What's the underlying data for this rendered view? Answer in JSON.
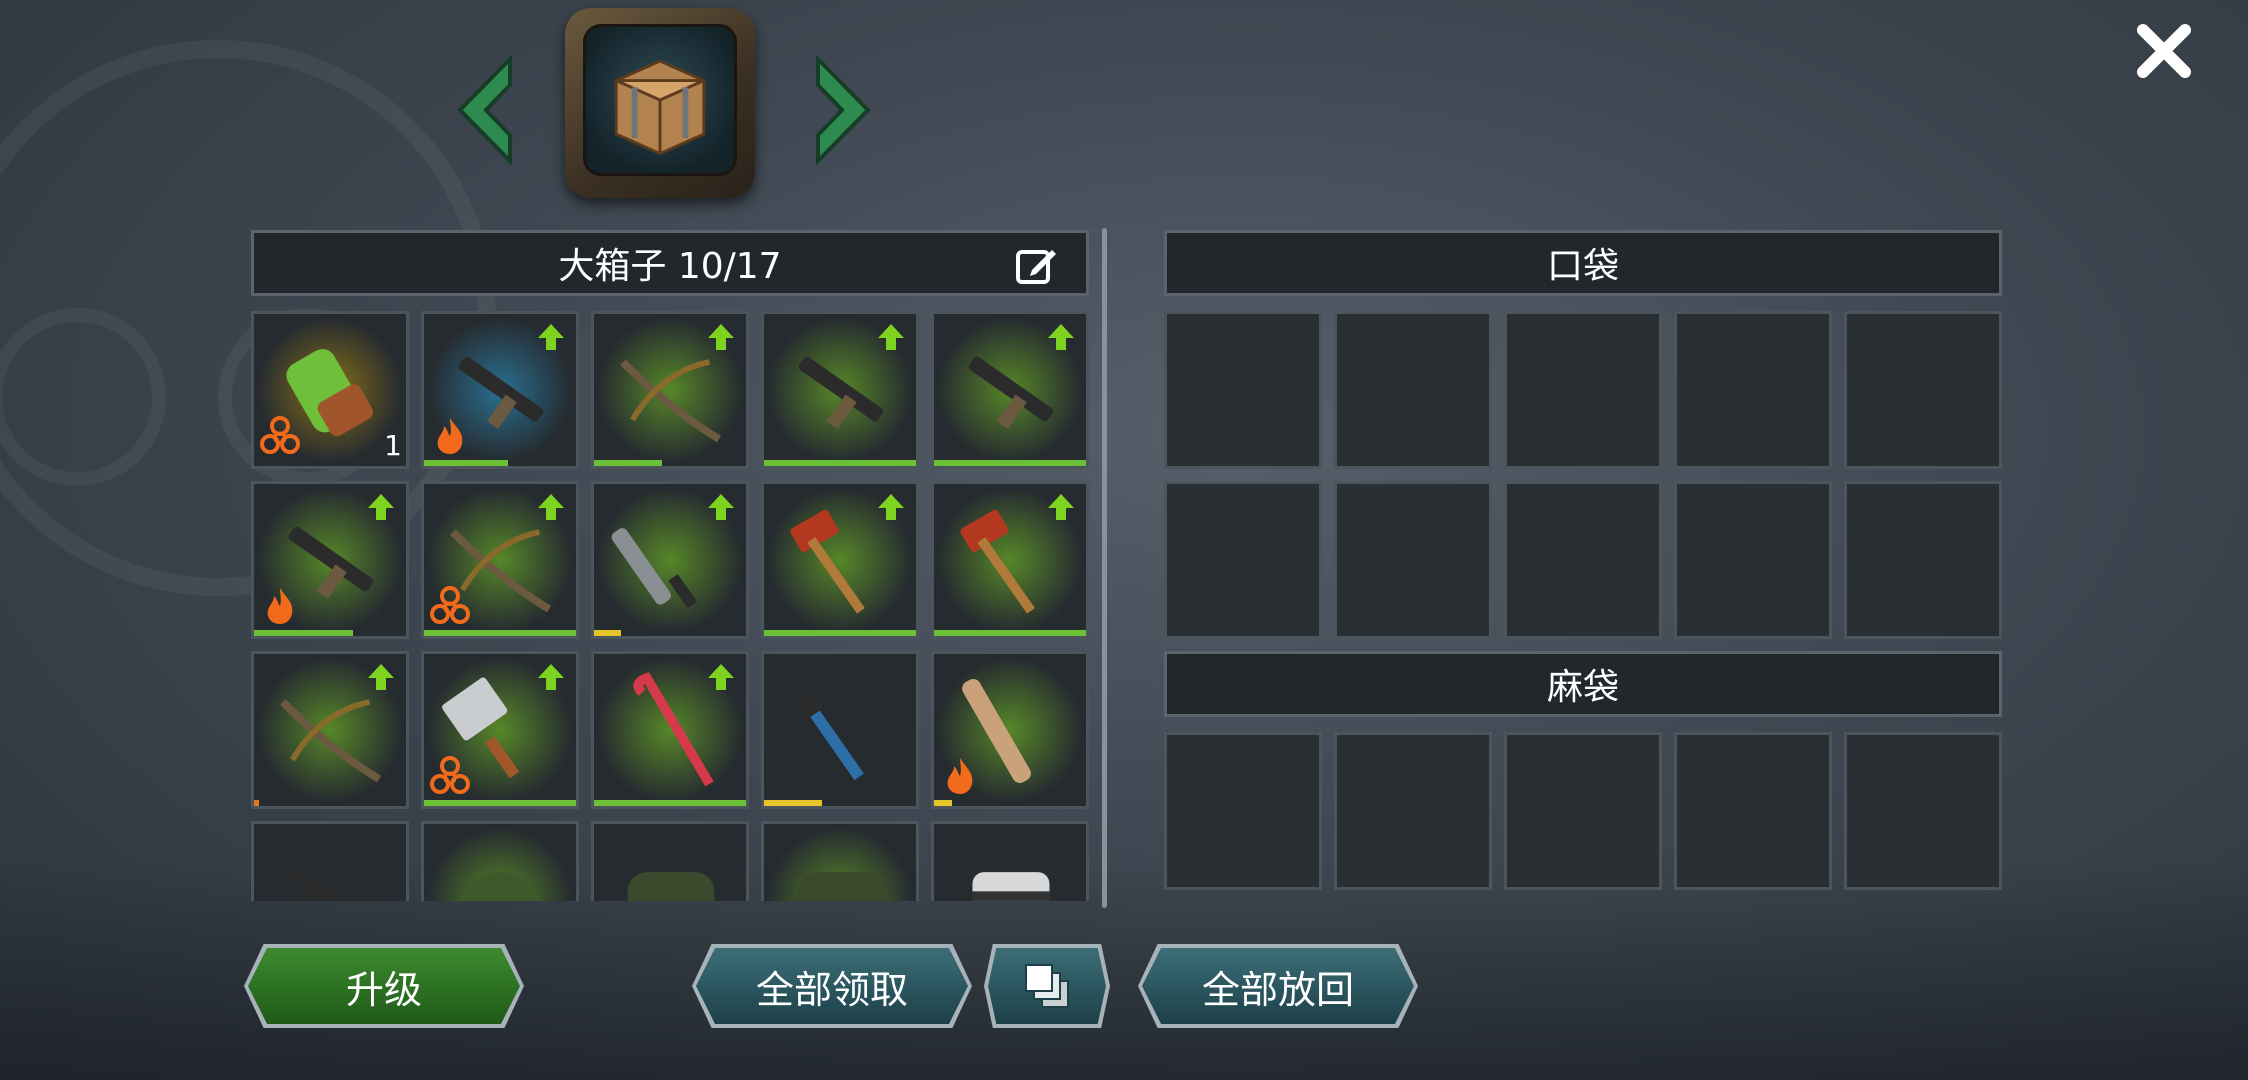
{
  "header": {
    "storage_title": "大箱子 10/17",
    "pocket_title": "口袋",
    "sack_title": "麻袋"
  },
  "storage": {
    "items": [
      {
        "name": "toxic-arm-cannon",
        "glow": "#d9a800",
        "up": false,
        "element": "biohazard",
        "qty": "1",
        "bar": null,
        "barColor": null
      },
      {
        "name": "ak-rifle",
        "glow": "#2ba8e0",
        "up": true,
        "element": "fire",
        "qty": "",
        "bar": 0.55,
        "barColor": "#6cc036"
      },
      {
        "name": "compound-bow",
        "glow": "#7ed321",
        "up": true,
        "element": "",
        "qty": "",
        "bar": 0.45,
        "barColor": "#6cc036"
      },
      {
        "name": "smg",
        "glow": "#7ed321",
        "up": true,
        "element": "",
        "qty": "",
        "bar": 1.0,
        "barColor": "#6cc036"
      },
      {
        "name": "smg",
        "glow": "#7ed321",
        "up": true,
        "element": "",
        "qty": "",
        "bar": 1.0,
        "barColor": "#6cc036"
      },
      {
        "name": "pump-shotgun",
        "glow": "#7ed321",
        "up": true,
        "element": "fire",
        "qty": "",
        "bar": 0.65,
        "barColor": "#6cc036"
      },
      {
        "name": "crossbow",
        "glow": "#7ed321",
        "up": true,
        "element": "biohazard",
        "qty": "",
        "bar": 1.0,
        "barColor": "#6cc036"
      },
      {
        "name": "machete",
        "glow": "#7ed321",
        "up": true,
        "element": "",
        "qty": "",
        "bar": 0.18,
        "barColor": "#e6c52a"
      },
      {
        "name": "sledgehammer",
        "glow": "#7ed321",
        "up": true,
        "element": "",
        "qty": "",
        "bar": 1.0,
        "barColor": "#6cc036"
      },
      {
        "name": "sledgehammer",
        "glow": "#7ed321",
        "up": true,
        "element": "",
        "qty": "",
        "bar": 1.0,
        "barColor": "#6cc036"
      },
      {
        "name": "crossbow",
        "glow": "#7ed321",
        "up": true,
        "element": "",
        "qty": "",
        "bar": 0.03,
        "barColor": "#e07a1a"
      },
      {
        "name": "cleaver",
        "glow": "#7ed321",
        "up": true,
        "element": "biohazard",
        "qty": "",
        "bar": 1.0,
        "barColor": "#6cc036"
      },
      {
        "name": "crowbar",
        "glow": "#7ed321",
        "up": true,
        "element": "",
        "qty": "",
        "bar": 1.0,
        "barColor": "#6cc036"
      },
      {
        "name": "pipe-wrench",
        "glow": "",
        "up": false,
        "element": "",
        "qty": "",
        "bar": 0.38,
        "barColor": "#e6c52a"
      },
      {
        "name": "spiked-bat",
        "glow": "#7ed321",
        "up": false,
        "element": "fire",
        "qty": "",
        "bar": 0.12,
        "barColor": "#e6c52a"
      },
      {
        "name": "rifle",
        "glow": "",
        "up": false,
        "element": "",
        "qty": "",
        "bar": null,
        "barColor": null
      },
      {
        "name": "helmet",
        "glow": "#7ed321",
        "up": false,
        "element": "",
        "qty": "",
        "bar": null,
        "barColor": null
      },
      {
        "name": "jacket",
        "glow": "",
        "up": false,
        "element": "",
        "qty": "",
        "bar": null,
        "barColor": null
      },
      {
        "name": "vest",
        "glow": "#7ed321",
        "up": false,
        "element": "",
        "qty": "",
        "bar": null,
        "barColor": null
      },
      {
        "name": "shirt",
        "glow": "",
        "up": false,
        "element": "",
        "qty": "",
        "bar": null,
        "barColor": null
      }
    ]
  },
  "pocket": {
    "slots": 10
  },
  "sack": {
    "slots": 5
  },
  "buttons": {
    "upgrade": "升级",
    "collect_all": "全部领取",
    "return_all": "全部放回"
  },
  "colors": {
    "accent_green": "#3d8a2e",
    "teal": "#2c5c66",
    "arrow_green": "#2e8a55"
  }
}
